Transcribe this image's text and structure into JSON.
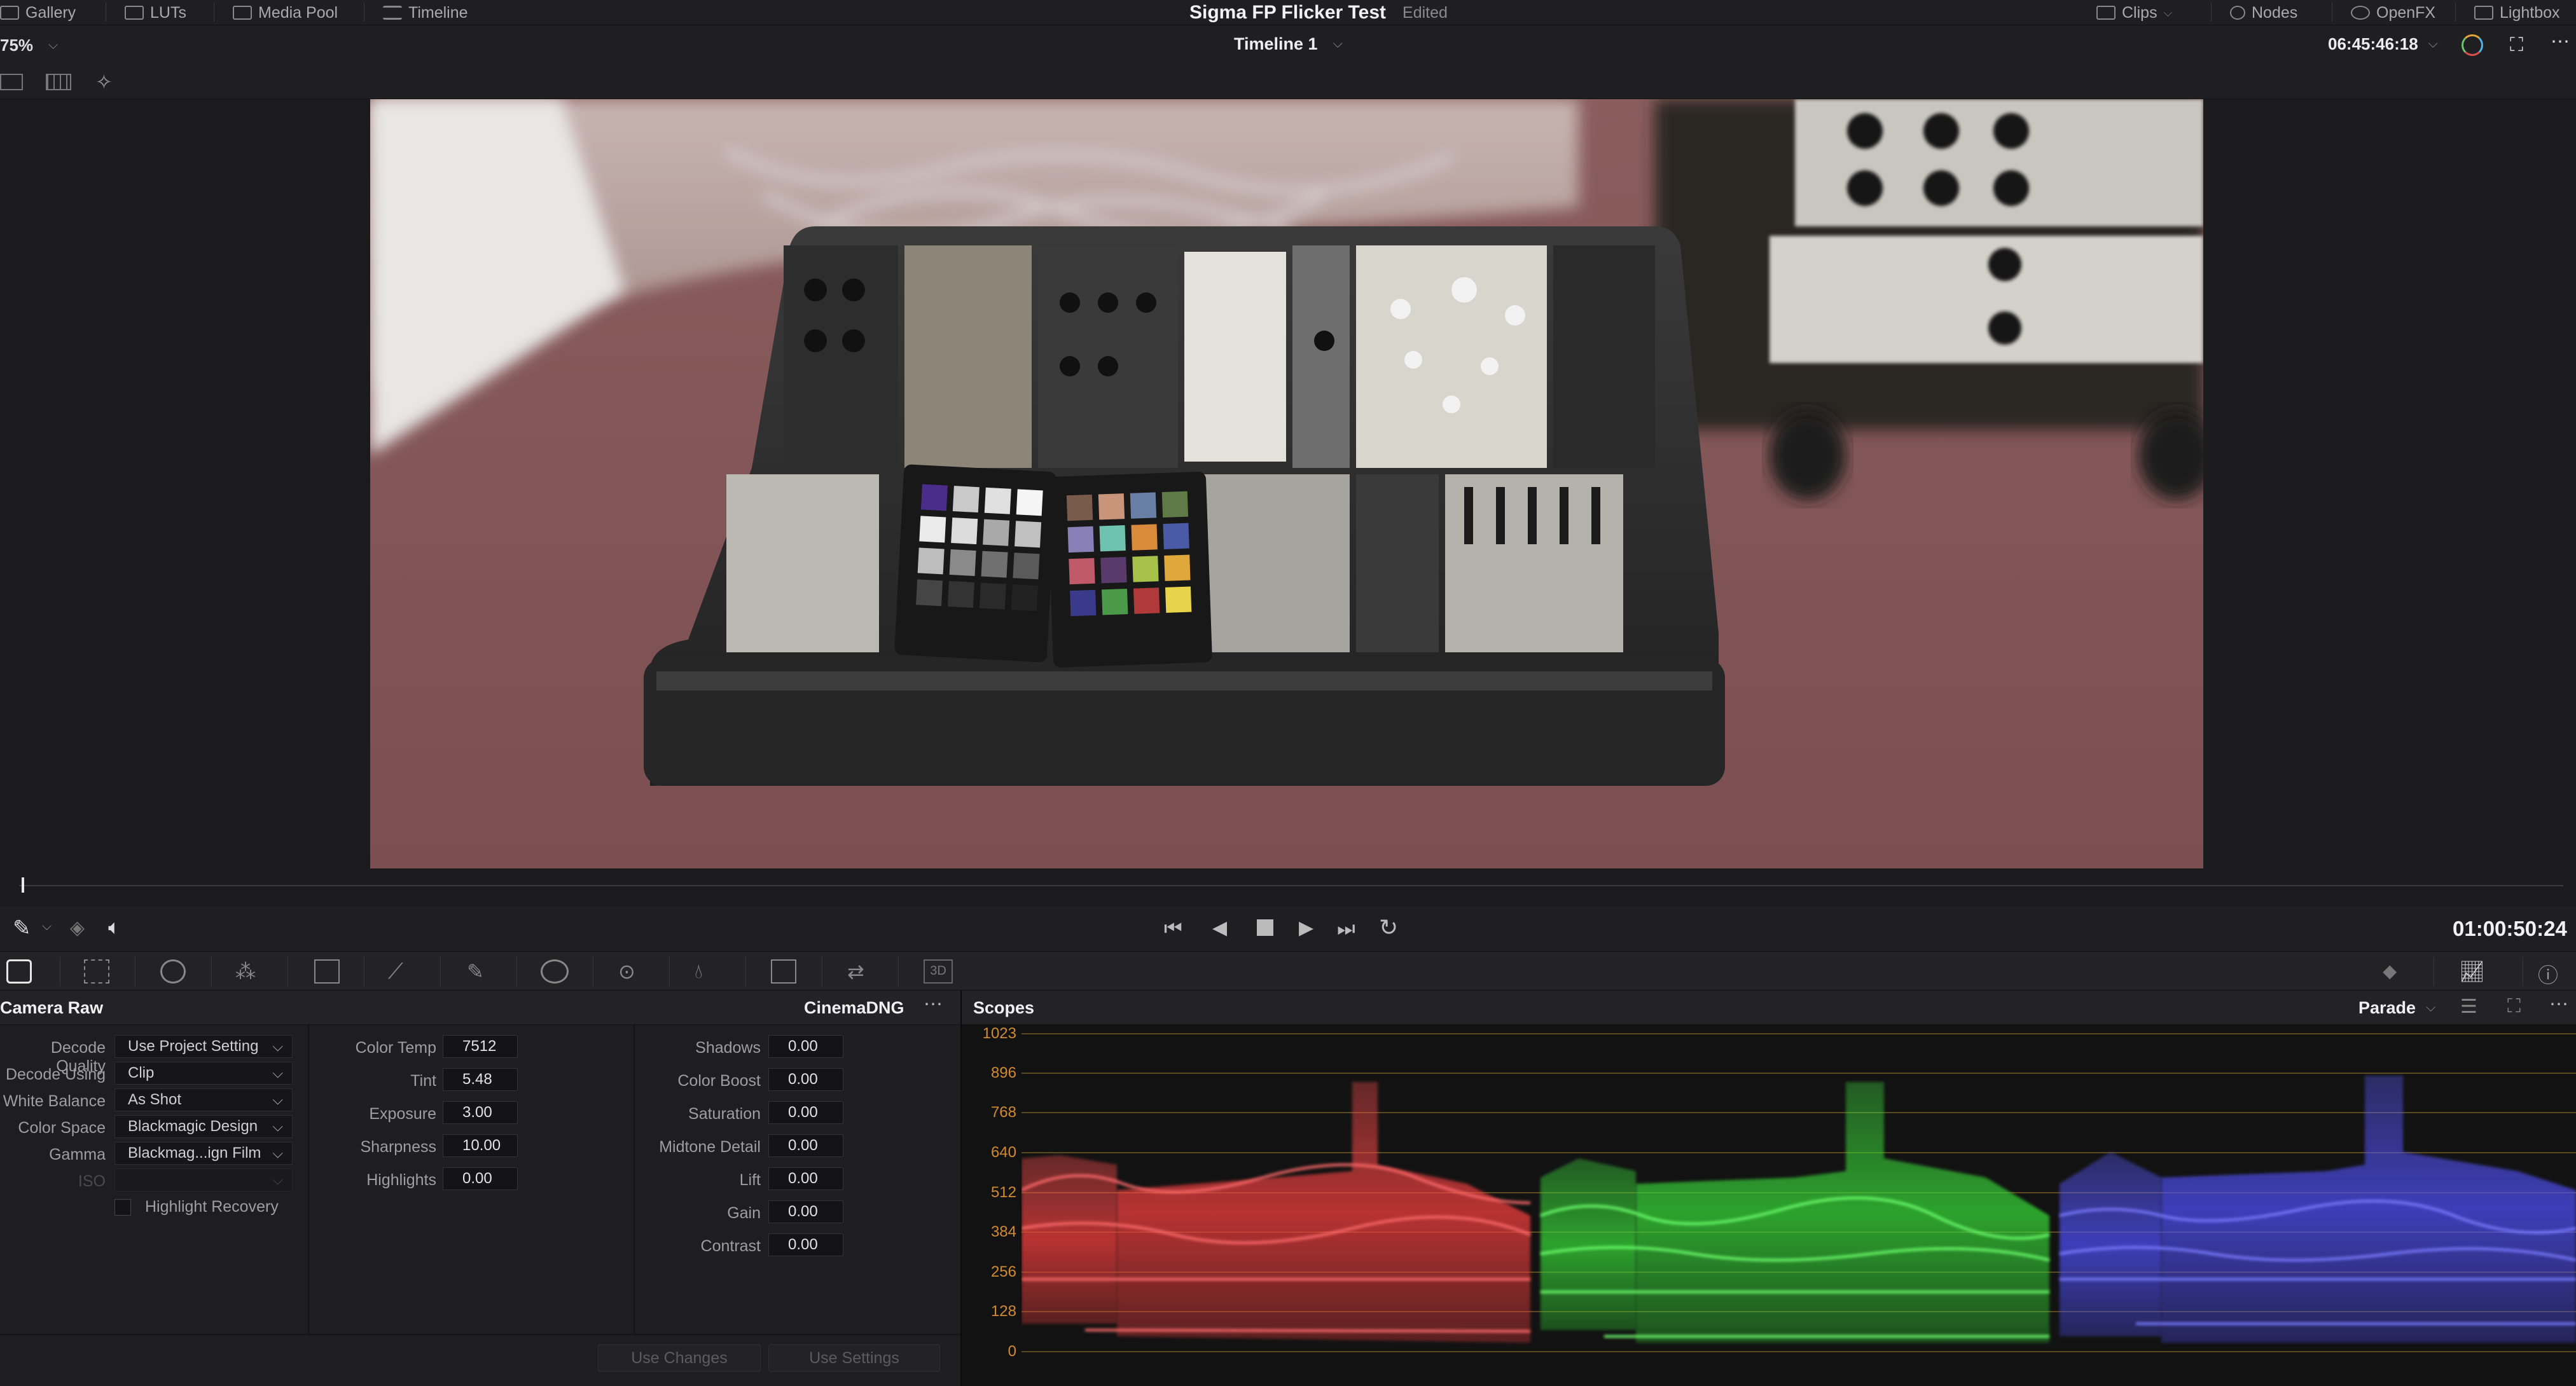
{
  "topbar": {
    "gallery": "Gallery",
    "luts": "LUTs",
    "media_pool": "Media Pool",
    "timeline": "Timeline",
    "project_title": "Sigma FP Flicker Test",
    "project_status": "Edited",
    "clips": "Clips",
    "nodes": "Nodes",
    "openfx": "OpenFX",
    "lightbox": "Lightbox"
  },
  "viewer": {
    "zoom": "75%",
    "timeline_name": "Timeline 1",
    "source_timecode": "06:45:46:18",
    "playhead_timecode": "01:00:50:24"
  },
  "camera_raw": {
    "title": "Camera Raw",
    "format": "CinemaDNG",
    "fields": [
      {
        "label": "Decode Quality",
        "value": "Use Project Setting"
      },
      {
        "label": "Decode Using",
        "value": "Clip"
      },
      {
        "label": "White Balance",
        "value": "As Shot"
      },
      {
        "label": "Color Space",
        "value": "Blackmagic Design"
      },
      {
        "label": "Gamma",
        "value": "Blackmag...ign Film"
      },
      {
        "label": "ISO",
        "value": ""
      }
    ],
    "highlight_recovery": "Highlight Recovery",
    "sliders_mid": [
      {
        "label": "Color Temp",
        "value": "7512"
      },
      {
        "label": "Tint",
        "value": "5.48"
      },
      {
        "label": "Exposure",
        "value": "3.00"
      },
      {
        "label": "Sharpness",
        "value": "10.00"
      },
      {
        "label": "Highlights",
        "value": "0.00"
      }
    ],
    "sliders_right": [
      {
        "label": "Shadows",
        "value": "0.00"
      },
      {
        "label": "Color Boost",
        "value": "0.00"
      },
      {
        "label": "Saturation",
        "value": "0.00"
      },
      {
        "label": "Midtone Detail",
        "value": "0.00"
      },
      {
        "label": "Lift",
        "value": "0.00"
      },
      {
        "label": "Gain",
        "value": "0.00"
      },
      {
        "label": "Contrast",
        "value": "0.00"
      }
    ],
    "use_changes": "Use Changes",
    "use_settings": "Use Settings"
  },
  "scopes": {
    "title": "Scopes",
    "mode": "Parade",
    "ticks": [
      "1023",
      "896",
      "768",
      "640",
      "512",
      "384",
      "256",
      "128",
      "0"
    ],
    "colors": {
      "red": "#ff4a4a",
      "green": "#3bdc3b",
      "blue": "#5a5aff",
      "tick": "#d28a2e"
    }
  },
  "toolbar": {
    "badge_3d": "3D"
  }
}
